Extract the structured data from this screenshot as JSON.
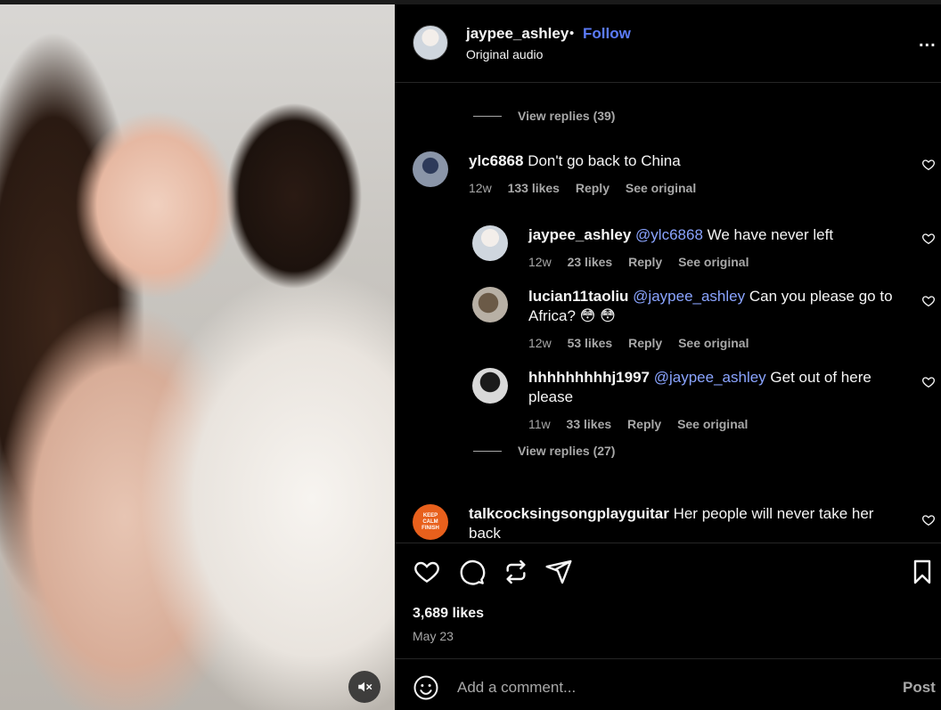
{
  "post": {
    "author": "jaypee_ashley",
    "separator": "•",
    "follow_label": "Follow",
    "audio": "Original audio",
    "more_label": "..."
  },
  "comments_top": {
    "view_replies_1": "View replies (39)"
  },
  "comments": [
    {
      "username": "ylc6868",
      "text": "Don't go back to China",
      "age": "12w",
      "likes": "133 likes",
      "reply_label": "Reply",
      "see_original_label": "See original"
    }
  ],
  "replies": [
    {
      "username": "jaypee_ashley",
      "mention": "@ylc6868",
      "text": "We have never left",
      "age": "12w",
      "likes": "23 likes",
      "reply_label": "Reply",
      "see_original_label": "See original"
    },
    {
      "username": "lucian11taoliu",
      "mention": "@jaypee_ashley",
      "text": "Can you please go to Africa? 😳  😳",
      "age": "12w",
      "likes": "53 likes",
      "reply_label": "Reply",
      "see_original_label": "See original"
    },
    {
      "username": "hhhhhhhhhj1997",
      "mention": "@jaypee_ashley",
      "text": "Get out of here please",
      "age": "11w",
      "likes": "33 likes",
      "reply_label": "Reply",
      "see_original_label": "See original"
    }
  ],
  "view_replies_2": "View replies (27)",
  "last_comment": {
    "username": "talkcocksingsongplayguitar",
    "text": "Her people will never take her back",
    "avatar_text": "KEEP CALM FINISH"
  },
  "actions": {
    "likes": "3,689 likes",
    "date": "May 23"
  },
  "composer": {
    "placeholder": "Add a comment...",
    "post_label": "Post"
  },
  "icons": {
    "like": "heart-icon",
    "comment": "comment-icon",
    "repost": "repost-icon",
    "share": "share-icon",
    "save": "bookmark-icon",
    "emoji": "emoji-icon",
    "mute": "muted-speaker-icon"
  },
  "colors": {
    "accent": "#5b7bf8",
    "mention": "#8aa4ff",
    "background": "#000000",
    "secondary_text": "#a8a8a8"
  }
}
